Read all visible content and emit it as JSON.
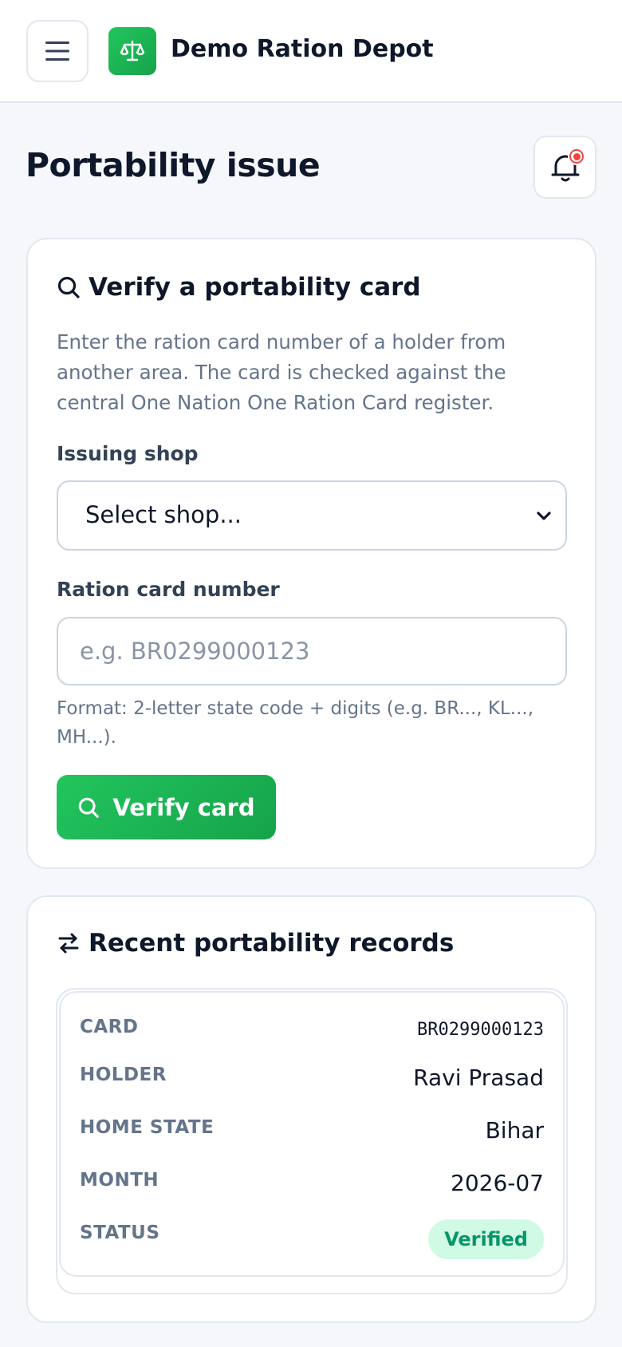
{
  "header": {
    "app_title": "Demo Ration Depot",
    "menu_icon": "hamburger-menu-icon",
    "logo_icon": "scales-icon",
    "brand_color": "#22c55e"
  },
  "page": {
    "title": "Portability issue",
    "notification_icon": "bell-icon"
  },
  "verify_card": {
    "title": "Verify a portability card",
    "title_icon": "search-icon",
    "description": "Enter the ration card number of a holder from another area. The card is checked against the central One Nation One Ration Card register.",
    "shop_label": "Issuing shop",
    "shop_selected": "Select shop...",
    "card_label": "Ration card number",
    "card_placeholder": "e.g. BR0299000123",
    "card_value": "",
    "format_hint": "Format: 2-letter state code + digits (e.g. BR..., KL..., MH...).",
    "verify_button": "Verify card"
  },
  "records": {
    "title": "Recent portability records",
    "title_icon": "swap-arrows-icon",
    "items": [
      {
        "card_key": "CARD",
        "card": "BR0299000123",
        "holder_key": "HOLDER",
        "holder": "Ravi Prasad",
        "state_key": "HOME STATE",
        "state": "Bihar",
        "month_key": "MONTH",
        "month": "2026-07",
        "status_key": "STATUS",
        "status": "Verified",
        "status_color": "#059669"
      }
    ]
  }
}
